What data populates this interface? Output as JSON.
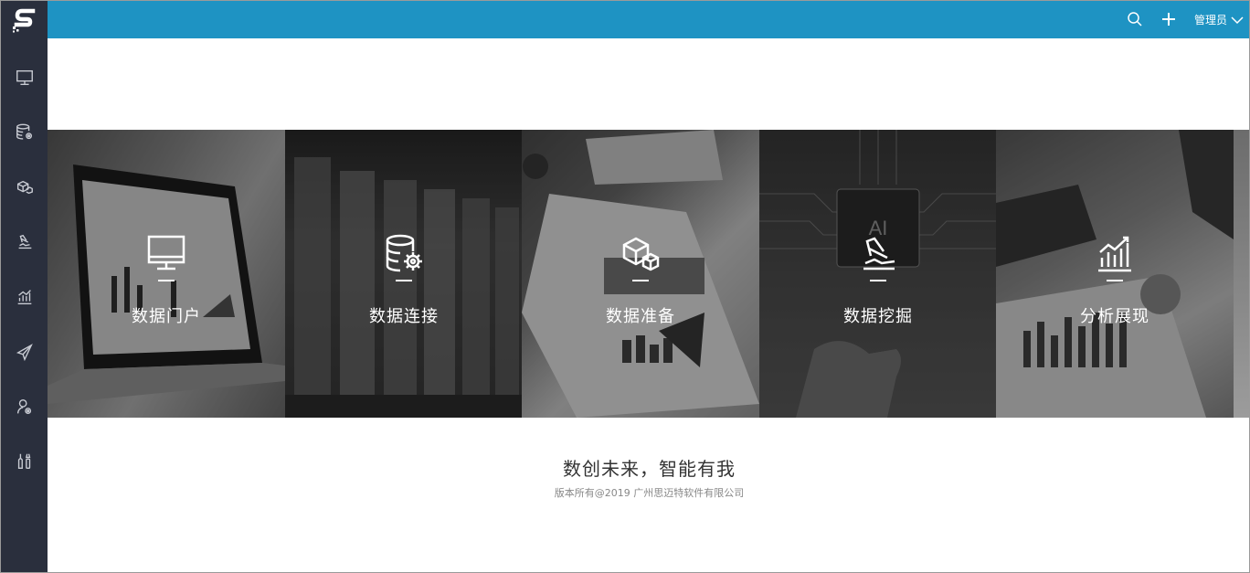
{
  "app": {
    "logo": "S"
  },
  "sidebar": {
    "items": [
      {
        "name": "monitor-icon"
      },
      {
        "name": "database-gear-icon"
      },
      {
        "name": "cubes-icon"
      },
      {
        "name": "mining-icon"
      },
      {
        "name": "bar-chart-icon"
      },
      {
        "name": "send-icon"
      },
      {
        "name": "user-gear-icon"
      },
      {
        "name": "tools-icon"
      }
    ]
  },
  "header": {
    "user_label": "管理员",
    "accent": "#1e93c3"
  },
  "tiles": [
    {
      "label": "数据门户",
      "icon": "monitor-icon",
      "selected": false
    },
    {
      "label": "数据连接",
      "icon": "database-gear-icon",
      "selected": true
    },
    {
      "label": "数据准备",
      "icon": "cubes-icon",
      "selected": false
    },
    {
      "label": "数据挖掘",
      "icon": "mining-icon",
      "selected": false
    },
    {
      "label": "分析展现",
      "icon": "bar-chart-icon",
      "selected": false
    }
  ],
  "footer": {
    "slogan": "数创未来，智能有我",
    "copyright": "版本所有@2019 广州思迈特软件有限公司"
  },
  "colors": {
    "sidebar_bg": "#2a2f3d",
    "selection": "#e01b1b"
  }
}
